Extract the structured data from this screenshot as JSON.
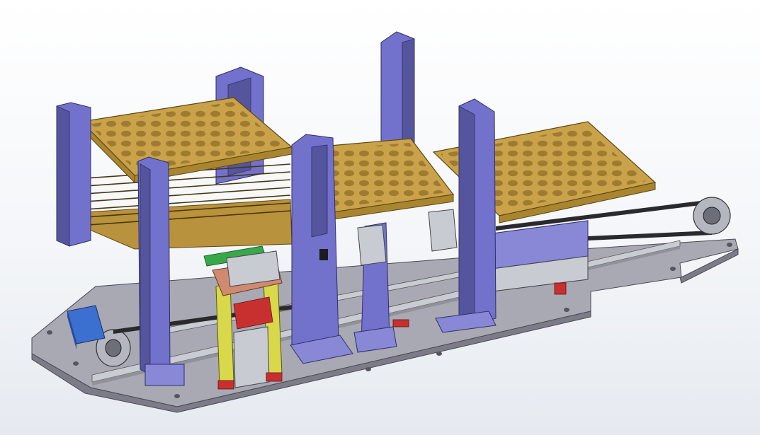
{
  "scene": {
    "subject": "machine-assembly",
    "colors": {
      "background_top": "#ffffff",
      "background_bottom": "#e6eaf0",
      "base_plate": "#9a9aa4",
      "base_plate_top": "#b7b7c0",
      "tray_gold": "#c9a24a",
      "tray_gold_dark": "#8a6a22",
      "upright_blue": "#6f6fc8",
      "upright_blue_dark": "#4b4b9a",
      "cylinder_yellow": "#d8d84a",
      "accent_red": "#c83030",
      "accent_green": "#38a84a",
      "accent_copper": "#d08a70",
      "motor_blue": "#3b6fd0",
      "steel": "#c0c4cc"
    }
  }
}
